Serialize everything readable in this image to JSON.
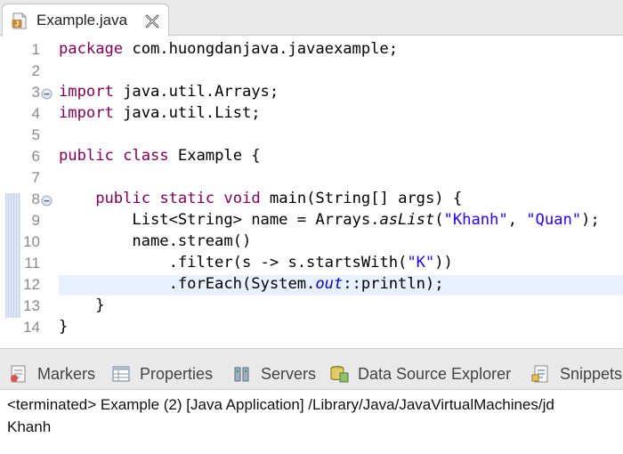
{
  "editor_tab": {
    "title": "Example.java",
    "icon": "java-file-icon"
  },
  "code_lines": [
    {
      "num": "1",
      "fold": false
    },
    {
      "num": "2",
      "fold": false
    },
    {
      "num": "3",
      "fold": true
    },
    {
      "num": "4",
      "fold": false
    },
    {
      "num": "5",
      "fold": false
    },
    {
      "num": "6",
      "fold": false
    },
    {
      "num": "7",
      "fold": false
    },
    {
      "num": "8",
      "fold": true
    },
    {
      "num": "9",
      "fold": false
    },
    {
      "num": "10",
      "fold": false
    },
    {
      "num": "11",
      "fold": false
    },
    {
      "num": "12",
      "fold": false,
      "current": true
    },
    {
      "num": "13",
      "fold": false
    },
    {
      "num": "14",
      "fold": false
    }
  ],
  "code": {
    "l1": {
      "kw": "package",
      "rest": " com.huongdanjava.javaexample;"
    },
    "l3": {
      "kw": "import",
      "rest": " java.util.Arrays;"
    },
    "l4": {
      "kw": "import",
      "rest": " java.util.List;"
    },
    "l6": {
      "kw1": "public",
      "kw2": "class",
      "rest": " Example {"
    },
    "l8": {
      "indent": "    ",
      "kw1": "public",
      "kw2": "static",
      "kw3": "void",
      "rest": " main(String[] args) {"
    },
    "l9": {
      "indent": "        ",
      "a": "List<String> name = Arrays.",
      "it": "asList",
      "b": "(",
      "s1": "\"Khanh\"",
      "c": ", ",
      "s2": "\"Quan\"",
      "d": ");"
    },
    "l10": {
      "text": "        name.stream()"
    },
    "l11": {
      "a": "            .filter(s -> s.startsWith(",
      "s": "\"K\"",
      "b": "))"
    },
    "l12": {
      "a": "            .forEach(System.",
      "field": "out",
      "b": "::println);"
    },
    "l13": {
      "text": "    }"
    },
    "l14": {
      "text": "}"
    }
  },
  "bottom_views": [
    {
      "label": "Markers",
      "icon": "markers-icon"
    },
    {
      "label": "Properties",
      "icon": "properties-icon"
    },
    {
      "label": "Servers",
      "icon": "servers-icon"
    },
    {
      "label": "Data Source Explorer",
      "icon": "data-source-explorer-icon"
    },
    {
      "label": "Snippets",
      "icon": "snippets-icon"
    }
  ],
  "console": {
    "status": "<terminated> Example (2) [Java Application] /Library/Java/JavaVirtualMachines/jd",
    "output": "Khanh"
  },
  "colors": {
    "keyword": "#7f0055",
    "string": "#2a00ff",
    "field": "#0000c0",
    "current_line": "#e8f2fe"
  }
}
